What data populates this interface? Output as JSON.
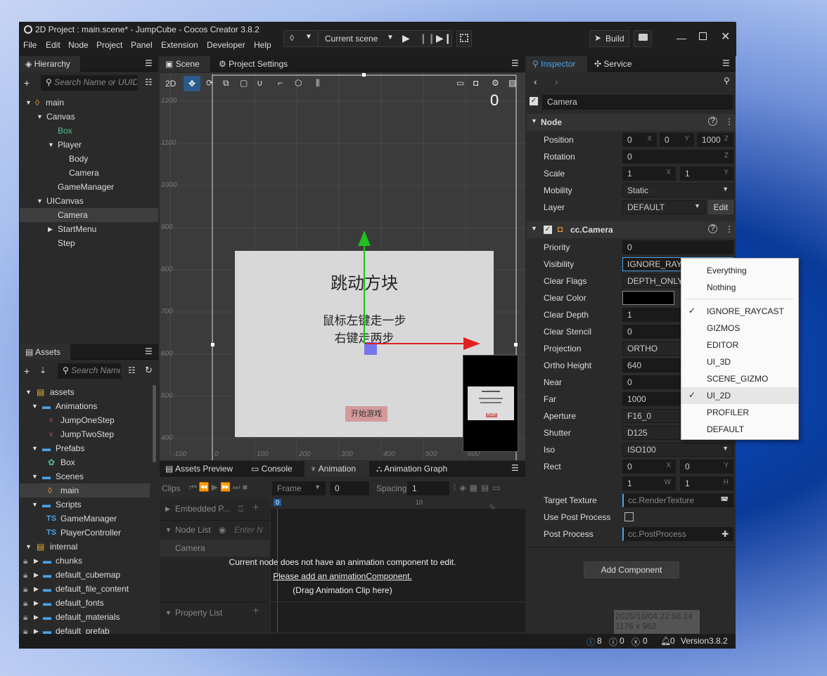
{
  "window": {
    "title": "2D Project : main.scene* - JumpCube - Cocos Creator 3.8.2",
    "menus": [
      "File",
      "Edit",
      "Node",
      "Project",
      "Panel",
      "Extension",
      "Developer",
      "Help"
    ],
    "scene_selector": "Current scene",
    "build_label": "Build"
  },
  "hierarchy": {
    "tab": "Hierarchy",
    "search_placeholder": "Search Name or UUID",
    "items": [
      "main",
      "Canvas",
      "Box",
      "Player",
      "Body",
      "Camera",
      "GameManager",
      "UICanvas",
      "Camera",
      "StartMenu",
      "Step"
    ]
  },
  "assets": {
    "tab": "Assets",
    "search_placeholder": "Search Name",
    "items": [
      "assets",
      "Animations",
      "JumpOneStep",
      "JumpTwoStep",
      "Prefabs",
      "Box",
      "Scenes",
      "main",
      "Scripts",
      "GameManager",
      "PlayerController",
      "internal",
      "chunks",
      "default_cubemap",
      "default_file_content",
      "default_fonts",
      "default_materials",
      "default_prefab"
    ],
    "ts_badge": "TS"
  },
  "scene": {
    "tabs": [
      "Scene",
      "Project Settings"
    ],
    "mode_2d": "2D",
    "y_ticks": [
      "1200",
      "1100",
      "1000",
      "900",
      "800",
      "700",
      "600",
      "500",
      "400"
    ],
    "x_ticks": [
      "-100",
      "0",
      "100",
      "200",
      "300",
      "400",
      "500",
      "600"
    ],
    "corner_label": "0",
    "game_title": "跳动方块",
    "instructions_1": "鼠标左键走一步",
    "instructions_2": "右键走两步",
    "start_button": "开始游戏",
    "preview_label": "PLAY"
  },
  "bottom": {
    "tabs": [
      "Assets Preview",
      "Console",
      "Animation",
      "Animation Graph"
    ],
    "clips_label": "Clips",
    "frame_label": "Frame",
    "frame_value": "0",
    "spacing_label": "Spacing",
    "spacing_value": "1",
    "embedded_label": "Embedded P...",
    "node_list_label": "Node List",
    "node_filter_placeholder": "Enter N",
    "node_item": "Camera",
    "property_list_label": "Property List",
    "timeline_0": "0",
    "timeline_10": "10",
    "msg_1": "Current node does not have an animation component to edit.",
    "msg_2": "Please add an animationComponent.",
    "msg_3": "(Drag Animation Clip here)"
  },
  "inspector": {
    "tabs": [
      "Inspector",
      "Service"
    ],
    "node_name": "Camera",
    "node_section": "Node",
    "position": {
      "label": "Position",
      "x": "0",
      "y": "0",
      "z": "1000"
    },
    "rotation": {
      "label": "Rotation",
      "z": "0"
    },
    "scale": {
      "label": "Scale",
      "x": "1",
      "y": "1"
    },
    "mobility": {
      "label": "Mobility",
      "value": "Static"
    },
    "layer": {
      "label": "Layer",
      "value": "DEFAULT",
      "edit": "Edit"
    },
    "camera_section": "cc.Camera",
    "props": [
      {
        "label": "Priority",
        "value": "0"
      },
      {
        "label": "Visibility",
        "value": "IGNORE_RAYCAST"
      },
      {
        "label": "Clear Flags",
        "value": "DEPTH_ONLY"
      },
      {
        "label": "Clear Color",
        "value": ""
      },
      {
        "label": "Clear Depth",
        "value": "1"
      },
      {
        "label": "Clear Stencil",
        "value": "0"
      },
      {
        "label": "Projection",
        "value": "ORTHO"
      },
      {
        "label": "Ortho Height",
        "value": "640"
      },
      {
        "label": "Near",
        "value": "0"
      },
      {
        "label": "Far",
        "value": "1000"
      },
      {
        "label": "Aperture",
        "value": "F16_0"
      },
      {
        "label": "Shutter",
        "value": "D125"
      },
      {
        "label": "Iso",
        "value": "ISO100"
      }
    ],
    "rect": {
      "label": "Rect",
      "x": "0",
      "y": "0",
      "w": "1",
      "h": "1"
    },
    "target_texture": {
      "label": "Target Texture",
      "value": "cc.RenderTexture"
    },
    "use_post_process": "Use Post Process",
    "post_process": {
      "label": "Post Process",
      "value": "cc.PostProcess"
    },
    "add_component": "Add Component",
    "axis_letters": {
      "x": "X",
      "y": "Y",
      "z": "Z",
      "w": "W",
      "h": "H"
    }
  },
  "dropdown": {
    "items": [
      {
        "label": "Everything",
        "checked": false
      },
      {
        "label": "Nothing",
        "checked": false
      },
      {
        "label": "IGNORE_RAYCAST",
        "checked": true
      },
      {
        "label": "GIZMOS",
        "checked": false
      },
      {
        "label": "EDITOR",
        "checked": false
      },
      {
        "label": "UI_3D",
        "checked": false
      },
      {
        "label": "SCENE_GIZMO",
        "checked": false
      },
      {
        "label": "UI_2D",
        "checked": true
      },
      {
        "label": "PROFILER",
        "checked": false
      },
      {
        "label": "DEFAULT",
        "checked": false
      }
    ],
    "check": "✓"
  },
  "status": {
    "info_count": "8",
    "warn_count": "0",
    "error_count": "0",
    "notify_count": "0",
    "version": "Version3.8.2"
  },
  "overlay": {
    "timestamp": "2025/10/04 22:58.14",
    "size": "1176 x 962"
  },
  "colors": {
    "accent": "#4aa3e8",
    "selected_bg": "#3e3e3e",
    "x_axis": "#e02020",
    "y_axis": "#20c020"
  }
}
